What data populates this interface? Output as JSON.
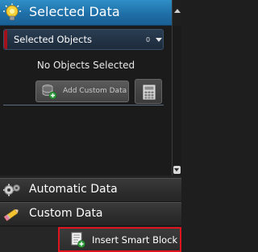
{
  "header": {
    "title": "Selected Data",
    "icon": "lightbulb-gear-icon"
  },
  "selection": {
    "dropdown_label": "Selected Objects",
    "count": "0",
    "empty_message": "No Objects Selected"
  },
  "buttons": {
    "add_custom_data": "Add Custom Data",
    "calculator_icon": "calculator-icon"
  },
  "sections": {
    "automatic_data": "Automatic Data",
    "custom_data": "Custom Data"
  },
  "footer": {
    "insert_smart_block": "Insert Smart Block"
  },
  "colors": {
    "header_blue": "#2a82bd",
    "highlight_red": "#e0141e",
    "dropdown_accent": "#a3121a"
  }
}
